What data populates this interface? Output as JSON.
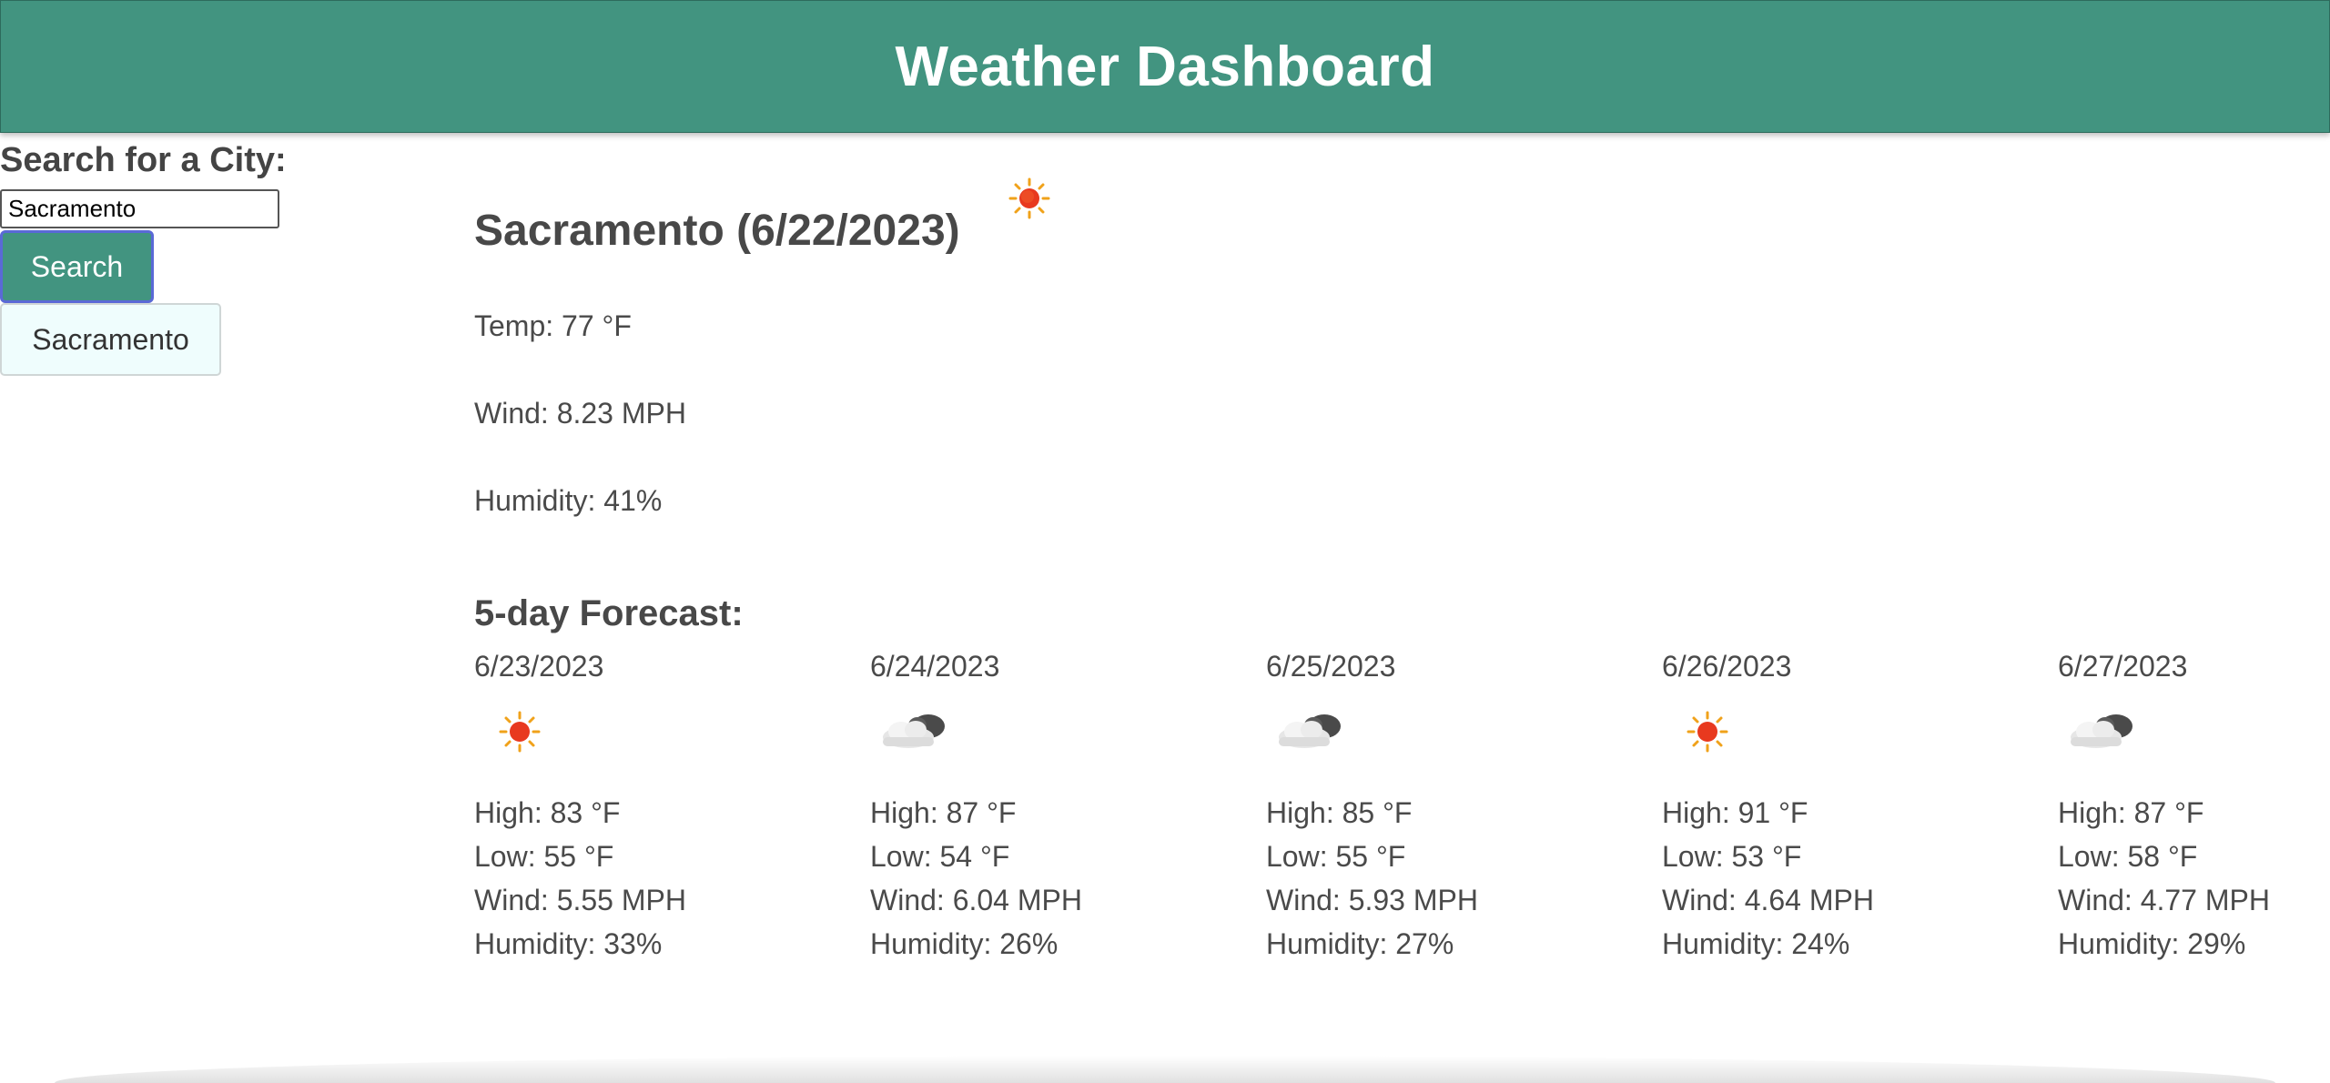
{
  "app": {
    "title": "Weather Dashboard"
  },
  "sidebar": {
    "search_label": "Search for a City:",
    "search_value": "Sacramento",
    "search_button": "Search",
    "history": [
      "Sacramento"
    ]
  },
  "current": {
    "heading": "Sacramento (6/22/2023)",
    "icon": "sun-icon",
    "temp": "Temp: 77 °F",
    "wind": "Wind: 8.23 MPH",
    "humidity": "Humidity: 41%"
  },
  "forecast": {
    "title": "5-day Forecast:",
    "days": [
      {
        "date": "6/23/2023",
        "icon": "sun-icon",
        "high": "High: 83 °F",
        "low": "Low: 55 °F",
        "wind": "Wind: 5.55 MPH",
        "humidity": "Humidity: 33%"
      },
      {
        "date": "6/24/2023",
        "icon": "cloud-icon",
        "high": "High: 87 °F",
        "low": "Low: 54 °F",
        "wind": "Wind: 6.04 MPH",
        "humidity": "Humidity: 26%"
      },
      {
        "date": "6/25/2023",
        "icon": "cloud-icon",
        "high": "High: 85 °F",
        "low": "Low: 55 °F",
        "wind": "Wind: 5.93 MPH",
        "humidity": "Humidity: 27%"
      },
      {
        "date": "6/26/2023",
        "icon": "sun-icon",
        "high": "High: 91 °F",
        "low": "Low: 53 °F",
        "wind": "Wind: 4.64 MPH",
        "humidity": "Humidity: 24%"
      },
      {
        "date": "6/27/2023",
        "icon": "cloud-icon",
        "high": "High: 87 °F",
        "low": "Low: 58 °F",
        "wind": "Wind: 4.77 MPH",
        "humidity": "Humidity: 29%"
      }
    ]
  },
  "colors": {
    "header_bg": "#429480",
    "button_bg": "#429480",
    "history_bg": "#effdfd"
  }
}
